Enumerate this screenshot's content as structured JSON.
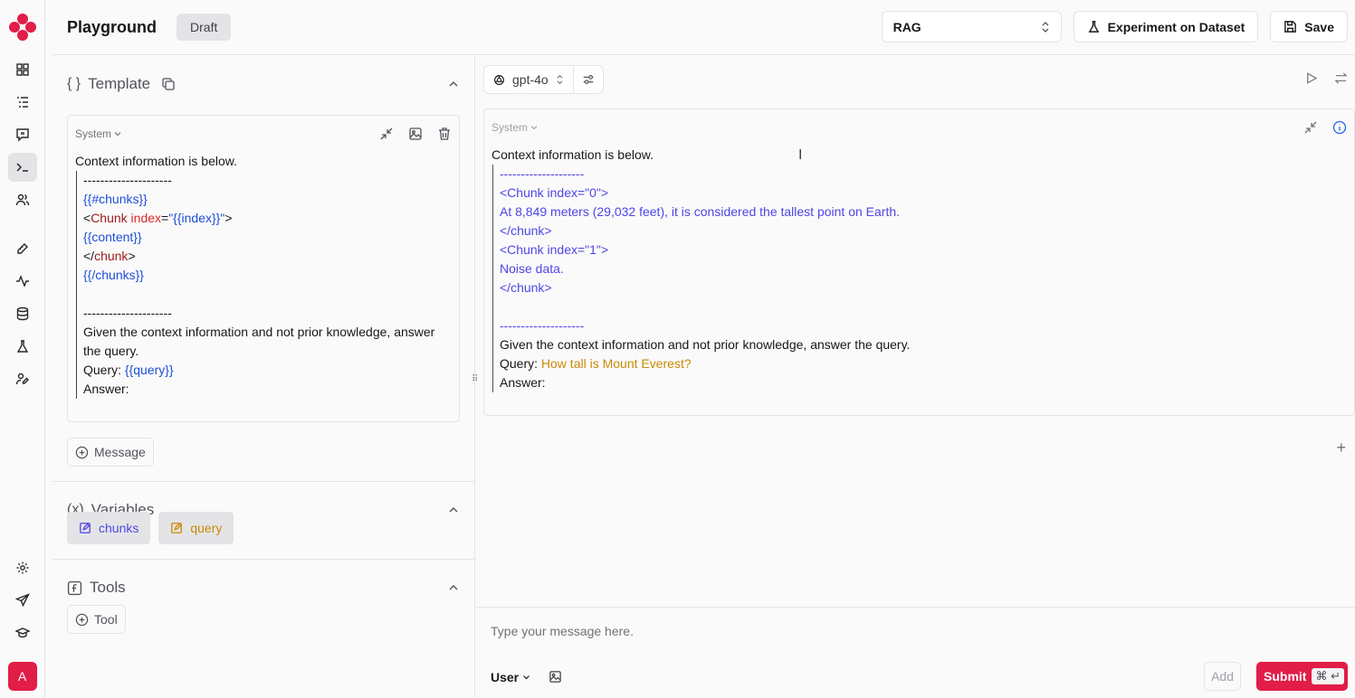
{
  "header": {
    "title": "Playground",
    "badge": "Draft",
    "prompt_select": "RAG",
    "experiment_label": "Experiment on Dataset",
    "save_label": "Save"
  },
  "user": {
    "avatar_initial": "A"
  },
  "template": {
    "heading": "Template",
    "message": {
      "role": "System",
      "intro": "Context information is below.",
      "lines": [
        {
          "parts": [
            {
              "text": "---------------------",
              "cls": ""
            }
          ]
        },
        {
          "parts": [
            {
              "text": "{{#chunks}}",
              "cls": "blue"
            }
          ]
        },
        {
          "parts": [
            {
              "text": "<",
              "cls": ""
            },
            {
              "text": "Chunk ",
              "cls": "darkred"
            },
            {
              "text": "index",
              "cls": "red"
            },
            {
              "text": "=",
              "cls": ""
            },
            {
              "text": "\"{{index}}\"",
              "cls": "blue"
            },
            {
              "text": ">",
              "cls": ""
            }
          ]
        },
        {
          "parts": [
            {
              "text": "{{content}}",
              "cls": "blue"
            }
          ]
        },
        {
          "parts": [
            {
              "text": "</",
              "cls": ""
            },
            {
              "text": "chunk",
              "cls": "darkred"
            },
            {
              "text": ">",
              "cls": ""
            }
          ]
        },
        {
          "parts": [
            {
              "text": "{{/chunks}}",
              "cls": "blue"
            }
          ]
        },
        {
          "parts": [
            {
              "text": " ",
              "cls": ""
            }
          ]
        },
        {
          "parts": [
            {
              "text": "---------------------",
              "cls": ""
            }
          ]
        },
        {
          "parts": [
            {
              "text": "Given the context information and not prior knowledge, answer the query.",
              "cls": ""
            }
          ]
        },
        {
          "parts": [
            {
              "text": "Query: ",
              "cls": ""
            },
            {
              "text": "{{query}}",
              "cls": "blue"
            }
          ]
        },
        {
          "parts": [
            {
              "text": "Answer:",
              "cls": ""
            }
          ]
        }
      ]
    },
    "add_message_label": "Message"
  },
  "variables": {
    "heading": "Variables",
    "items": [
      {
        "name": "chunks",
        "color": "#4f46e5"
      },
      {
        "name": "query",
        "color": "#ca8a04"
      }
    ]
  },
  "tools": {
    "heading": "Tools",
    "add_tool_label": "Tool"
  },
  "run": {
    "model": "gpt-4o",
    "message": {
      "role": "System",
      "intro": "Context information is below.",
      "lines": [
        {
          "parts": [
            {
              "text": "--------------------",
              "cls": "violet"
            }
          ]
        },
        {
          "parts": [
            {
              "text": "<Chunk index=\"0\">",
              "cls": "violet"
            }
          ]
        },
        {
          "parts": [
            {
              "text": "At 8,849 meters (29,032 feet), it is considered the tallest point on Earth.",
              "cls": "violet"
            }
          ]
        },
        {
          "parts": [
            {
              "text": "</chunk>",
              "cls": "violet"
            }
          ]
        },
        {
          "parts": [
            {
              "text": "<Chunk index=\"1\">",
              "cls": "violet"
            }
          ]
        },
        {
          "parts": [
            {
              "text": "Noise data.",
              "cls": "violet"
            }
          ]
        },
        {
          "parts": [
            {
              "text": "</chunk>",
              "cls": "violet"
            }
          ]
        },
        {
          "parts": [
            {
              "text": " ",
              "cls": ""
            }
          ]
        },
        {
          "parts": [
            {
              "text": "--------------------",
              "cls": "violet"
            }
          ]
        },
        {
          "parts": [
            {
              "text": "Given the context information and not prior knowledge, answer the query.",
              "cls": ""
            }
          ]
        },
        {
          "parts": [
            {
              "text": "Query: ",
              "cls": ""
            },
            {
              "text": "How tall is Mount Everest?",
              "cls": "amber"
            }
          ]
        },
        {
          "parts": [
            {
              "text": "Answer:",
              "cls": ""
            }
          ]
        }
      ]
    },
    "composer": {
      "placeholder": "Type your message here.",
      "role": "User",
      "add_label": "Add",
      "submit_label": "Submit",
      "shortcut": "⌘ ↵"
    }
  }
}
